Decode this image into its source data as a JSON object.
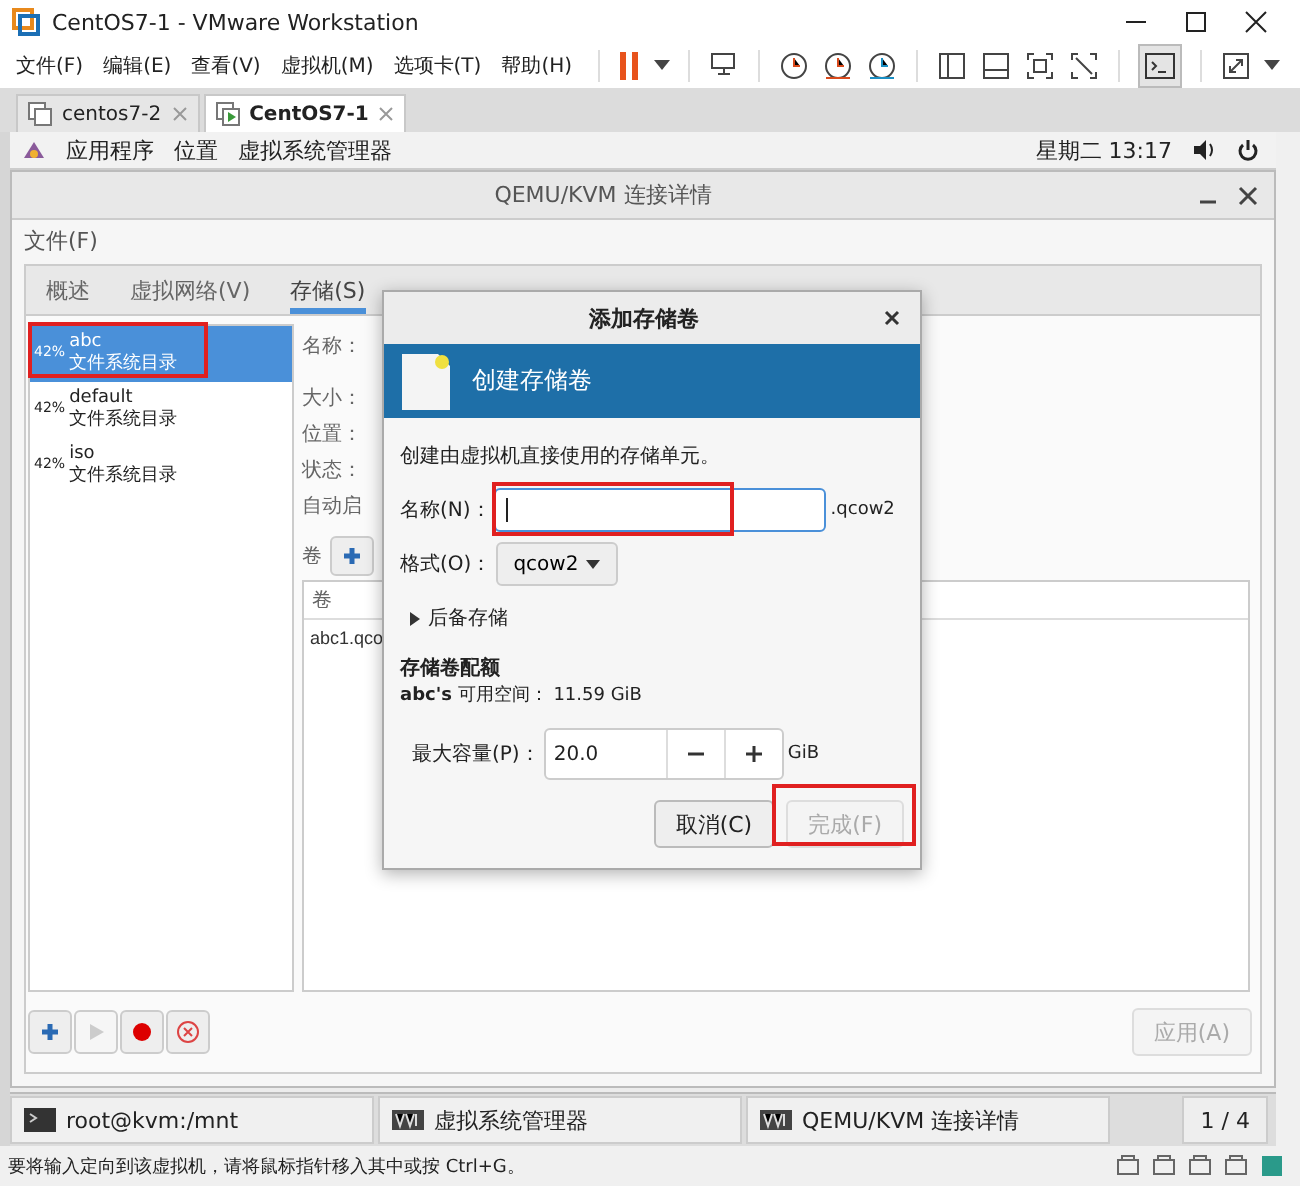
{
  "window": {
    "title": "CentOS7-1 - VMware Workstation"
  },
  "menu": [
    "文件(F)",
    "编辑(E)",
    "查看(V)",
    "虚拟机(M)",
    "选项卡(T)",
    "帮助(H)"
  ],
  "vm_tabs": [
    {
      "label": "centos7-2",
      "selected": false
    },
    {
      "label": "CentOS7-1",
      "selected": true
    }
  ],
  "gnome_bar": {
    "menus": [
      "应用程序",
      "位置",
      "虚拟系统管理器"
    ],
    "clock": "星期二 13:17"
  },
  "app_window": {
    "title": "QEMU/KVM 连接详情",
    "menu": [
      "文件(F)"
    ],
    "tabs": [
      {
        "label": "概述",
        "selected": false
      },
      {
        "label": "虚拟网络(V)",
        "selected": false
      },
      {
        "label": "存储(S)",
        "selected": true
      }
    ],
    "pools": [
      {
        "usage": "42%",
        "name": "abc",
        "type": "文件系统目录",
        "selected": true
      },
      {
        "usage": "42%",
        "name": "default",
        "type": "文件系统目录",
        "selected": false
      },
      {
        "usage": "42%",
        "name": "iso",
        "type": "文件系统目录",
        "selected": false
      }
    ],
    "details": {
      "labels": [
        "名称：",
        "大小：",
        "位置：",
        "状态：",
        "自动启"
      ],
      "volumes_label": "卷",
      "volume_column": "卷",
      "volumes": [
        "abc1.qco"
      ]
    },
    "pool_buttons": [
      {
        "kind": "add",
        "disabled": false
      },
      {
        "kind": "start",
        "disabled": true
      },
      {
        "kind": "stop",
        "disabled": false
      },
      {
        "kind": "delete",
        "disabled": false
      }
    ],
    "apply_button": {
      "label": "应用(A)",
      "disabled": true
    }
  },
  "dialog": {
    "title": "添加存储卷",
    "header": "创建存储卷",
    "description": "创建由虚拟机直接使用的存储单元。",
    "name_label": "名称(N)：",
    "name_suffix": ".qcow2",
    "format_label": "格式(O)：",
    "format": "qcow2",
    "backing": {
      "label": "后备存储",
      "expanded": false
    },
    "quota_title": "存储卷配额",
    "available": "**abc's** 可用空间： 11.59 GiB",
    "capacity_label": "最大容量(P)：",
    "capacity": "20.0",
    "capacity_unit": "GiB",
    "buttons": [
      {
        "label": "取消(C)",
        "disabled": false
      },
      {
        "label": "完成(F)",
        "disabled": true
      }
    ]
  },
  "taskbar": {
    "items": [
      {
        "label": "root@kvm:/mnt",
        "kind": "terminal"
      },
      {
        "label": "虚拟系统管理器",
        "kind": "manager"
      },
      {
        "label": "QEMU/KVM 连接详情",
        "kind": "manager"
      }
    ],
    "workspace": "1 / 4"
  },
  "status_bar": {
    "message": "要将输入定向到该虚拟机，请将鼠标指针移入其中或按 Ctrl+G。"
  }
}
